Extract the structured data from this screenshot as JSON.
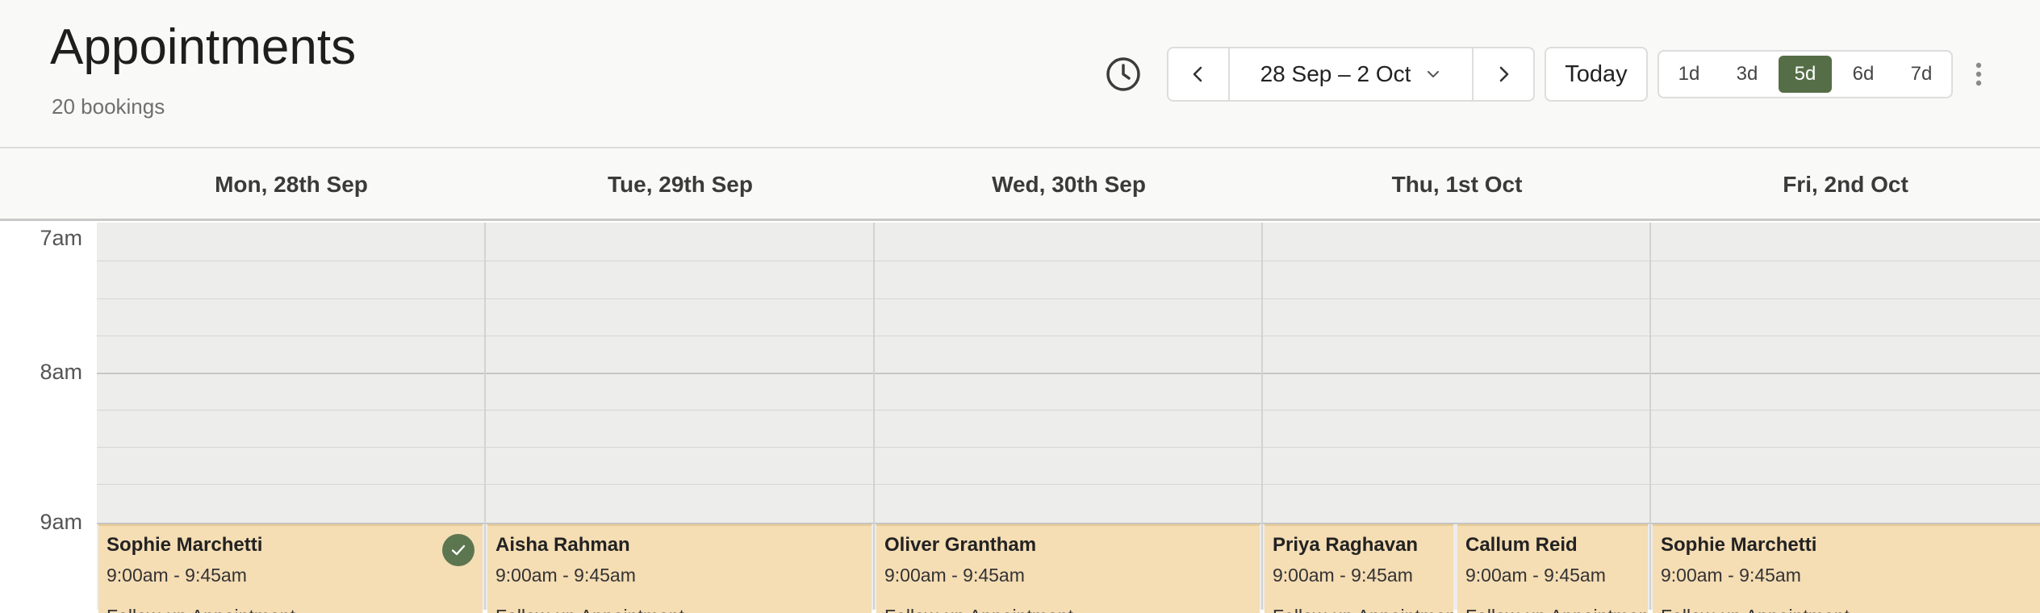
{
  "app": {
    "title": "Appointments",
    "subtitle": "20 bookings"
  },
  "toolbar": {
    "history_icon": "clock-icon",
    "date_range": "28 Sep – 2 Oct",
    "prev_icon": "chevron-left-icon",
    "next_icon": "chevron-right-icon",
    "today_label": "Today",
    "view_options": [
      "1d",
      "3d",
      "5d",
      "6d",
      "7d"
    ],
    "active_view": "5d",
    "more_icon": "kebab-menu-icon",
    "accent_color": "#556e47"
  },
  "days": [
    "Mon, 28th Sep",
    "Tue, 29th Sep",
    "Wed, 30th Sep",
    "Thu, 1st Oct",
    "Fri, 2nd Oct"
  ],
  "hours": [
    "7am",
    "8am",
    "9am"
  ],
  "appointments": [
    {
      "name": "Sophie Marchetti",
      "time": "9:00am - 9:45am",
      "note": "Follow-up Appointment",
      "confirmed": true
    },
    {
      "name": "Aisha Rahman",
      "time": "9:00am - 9:45am",
      "note": "Follow-up Appointment",
      "confirmed": false
    },
    {
      "name": "Oliver Grantham",
      "time": "9:00am - 9:45am",
      "note": "Follow-up Appointment",
      "confirmed": false
    },
    {
      "name": "Priya Raghavan",
      "time": "9:00am - 9:45am",
      "note": "Follow-up Appointment",
      "confirmed": false
    },
    {
      "name": "Callum Reid",
      "time": "9:00am - 9:45am",
      "note": "Follow-up Appointment",
      "confirmed": false
    },
    {
      "name": "Sophie Marchetti",
      "time": "9:00am - 9:45am",
      "note": "Follow-up Appointment",
      "confirmed": false
    }
  ],
  "colors": {
    "appointment_bg": "#f5ddb4",
    "confirmed_badge": "#5c7650",
    "grid_bg": "#ededec"
  }
}
